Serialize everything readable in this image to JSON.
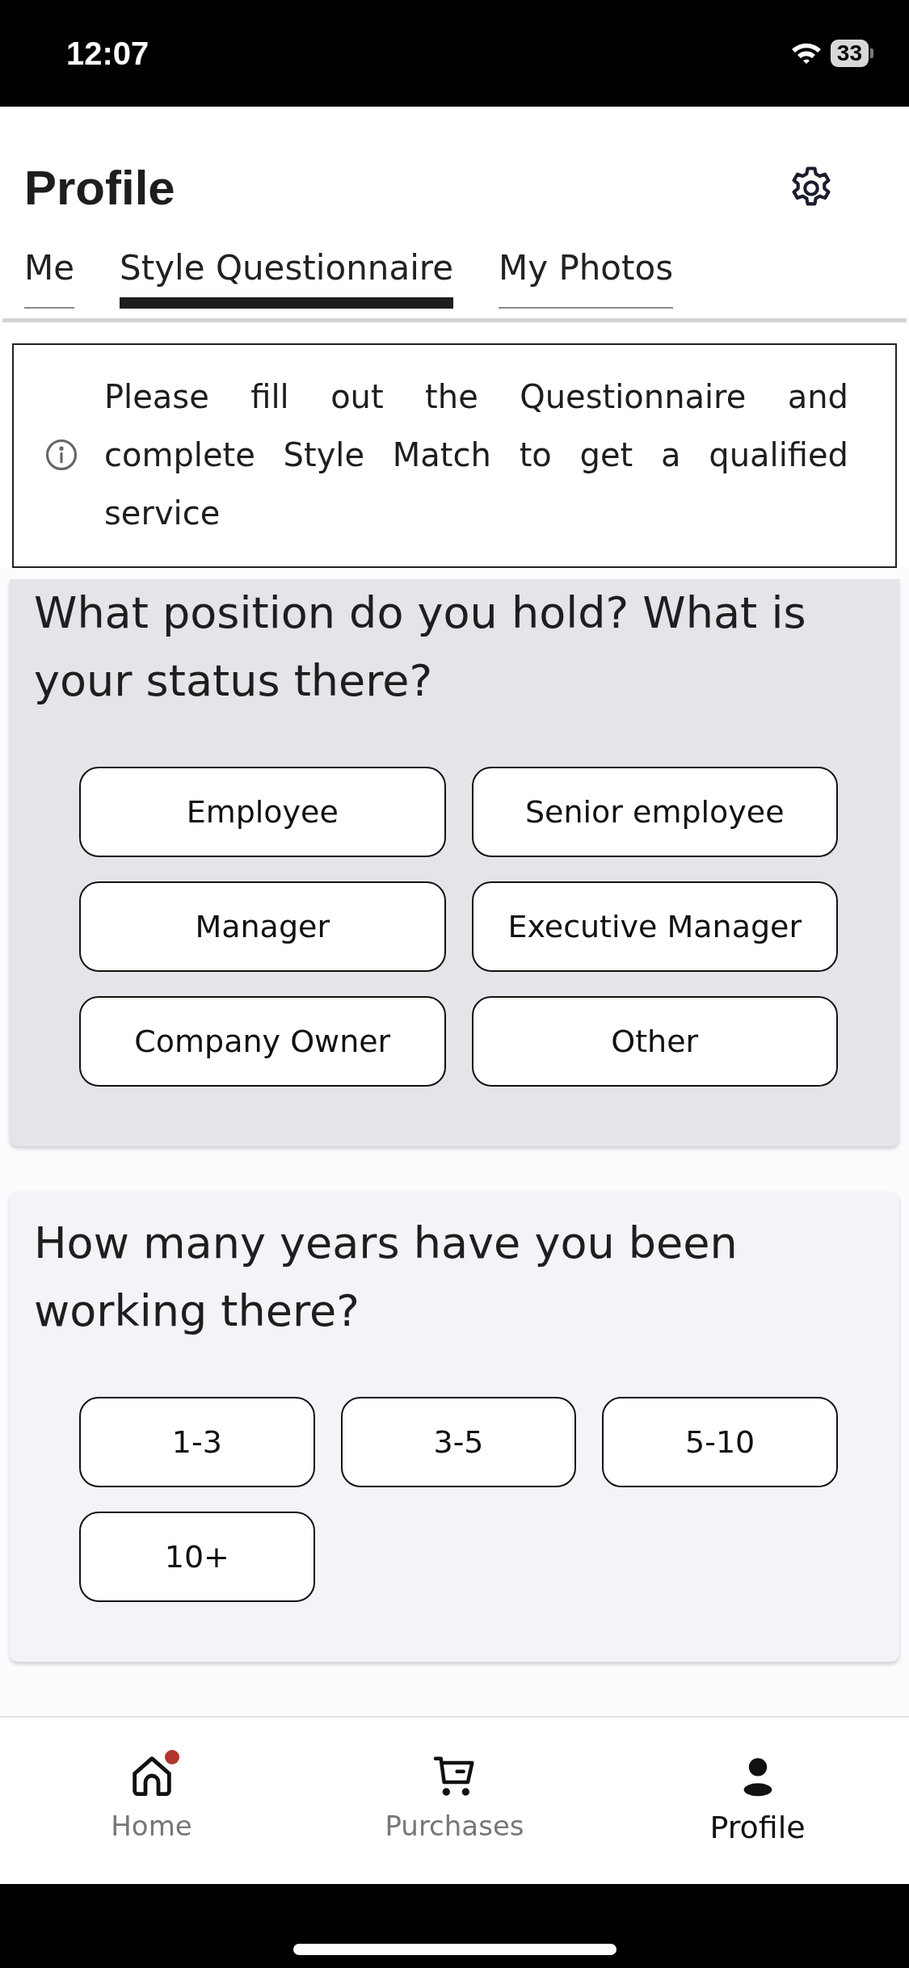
{
  "status_bar": {
    "time": "12:07",
    "battery": "33"
  },
  "header": {
    "title": "Profile"
  },
  "tabs": [
    {
      "label": "Me",
      "selected": false
    },
    {
      "label": "Style Questionnaire",
      "selected": true
    },
    {
      "label": "My Photos",
      "selected": false
    }
  ],
  "notice": {
    "text": "Please fill out the Questionnaire and complete Style Match to get a qualified service"
  },
  "questions": [
    {
      "title": "What position do you hold? What is your status there?",
      "active": true,
      "kind": "two-column",
      "options": [
        {
          "label": "Employee",
          "selected": false
        },
        {
          "label": "Senior employee",
          "selected": false
        },
        {
          "label": "Manager",
          "selected": false
        },
        {
          "label": "Executive Manager",
          "selected": false
        },
        {
          "label": "Company Owner",
          "selected": false
        },
        {
          "label": "Other",
          "selected": false
        }
      ]
    },
    {
      "title": "How many years have you been working there?",
      "active": false,
      "kind": "three-column",
      "options": [
        {
          "label": "1-3",
          "selected": false
        },
        {
          "label": "3-5",
          "selected": false
        },
        {
          "label": "5-10",
          "selected": false
        },
        {
          "label": "10+",
          "selected": false
        }
      ]
    }
  ],
  "nav": [
    {
      "label": "Home",
      "kind": "home",
      "selected": false,
      "badge": true
    },
    {
      "label": "Purchases",
      "kind": "cart",
      "selected": false,
      "badge": false
    },
    {
      "label": "Profile",
      "kind": "person",
      "selected": true,
      "badge": false
    }
  ]
}
